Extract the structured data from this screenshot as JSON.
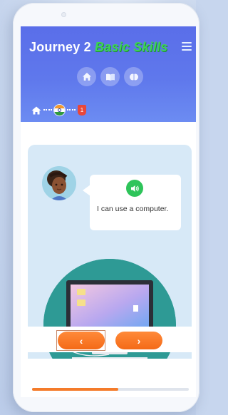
{
  "header": {
    "title_main": "Journey 2",
    "title_highlight": "Basic Skills",
    "icons": [
      "home-icon",
      "book-icon",
      "brain-icon"
    ]
  },
  "breadcrumb": {
    "items": [
      "home-icon",
      "india-flag",
      "level-badge"
    ],
    "badge_number": "1"
  },
  "lesson": {
    "speech_text": "I can use a computer.",
    "sound_icon": "speaker-icon"
  },
  "navigation": {
    "prev_label": "‹",
    "next_label": "›"
  },
  "progress": {
    "value_percent": 55
  },
  "colors": {
    "header": "#5a6ee9",
    "highlight": "#3fd15a",
    "accent": "#f47b2a",
    "card": "#d7e9f7",
    "scene": "#2e9a95"
  }
}
